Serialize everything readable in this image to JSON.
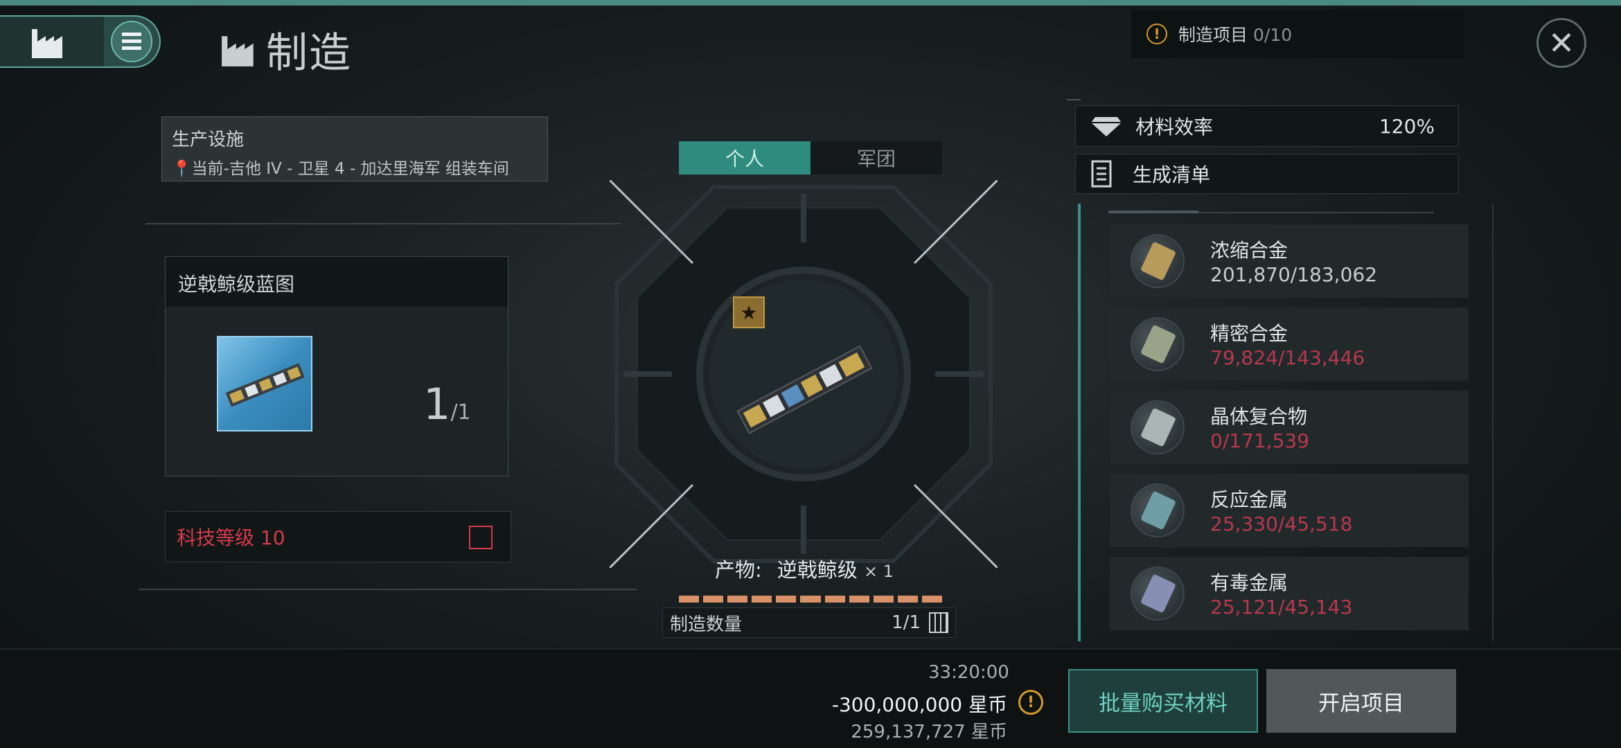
{
  "header": {
    "title": "制造",
    "project_label": "制造项目",
    "project_count": "0/10"
  },
  "facility": {
    "heading": "生产设施",
    "location": "当前-吉他 IV - 卫星 4 - 加达里海军 组装车间"
  },
  "blueprint": {
    "name": "逆戟鲸级蓝图",
    "count": "1",
    "count_total": "/1"
  },
  "tech": {
    "label": "科技等级 10"
  },
  "tabs": [
    {
      "label": "个人",
      "active": true
    },
    {
      "label": "军团",
      "active": false
    }
  ],
  "product": {
    "label": "产物:",
    "name": "逆戟鲸级",
    "multiplier": "× 1"
  },
  "quantity": {
    "label": "制造数量",
    "value": "1/1"
  },
  "efficiency": {
    "label": "材料效率",
    "value": "120%"
  },
  "list": {
    "label": "生成清单"
  },
  "materials": [
    {
      "name": "浓缩合金",
      "amount": "201,870/183,062",
      "sufficient": true,
      "icon": "alloy-icon",
      "color": "#b89a5a"
    },
    {
      "name": "精密合金",
      "amount": "79,824/143,446",
      "sufficient": false,
      "icon": "crystal-alloy-icon",
      "color": "#9aa38a"
    },
    {
      "name": "晶体复合物",
      "amount": "0/171,539",
      "sufficient": false,
      "icon": "crystal-compound-icon",
      "color": "#a9b6b4"
    },
    {
      "name": "反应金属",
      "amount": "25,330/45,518",
      "sufficient": false,
      "icon": "reactive-metal-icon",
      "color": "#6f9ea6"
    },
    {
      "name": "有毒金属",
      "amount": "25,121/45,143",
      "sufficient": false,
      "icon": "toxic-metal-icon",
      "color": "#8790b4"
    }
  ],
  "footer": {
    "timer": "33:20:00",
    "cost": "-300,000,000 星币",
    "balance": "259,137,727 星币",
    "buy_button": "批量购买材料",
    "start_button": "开启项目"
  },
  "colors": {
    "accent": "#2f8b7e",
    "warning": "#d49a2a",
    "insufficient": "#b8384d"
  }
}
